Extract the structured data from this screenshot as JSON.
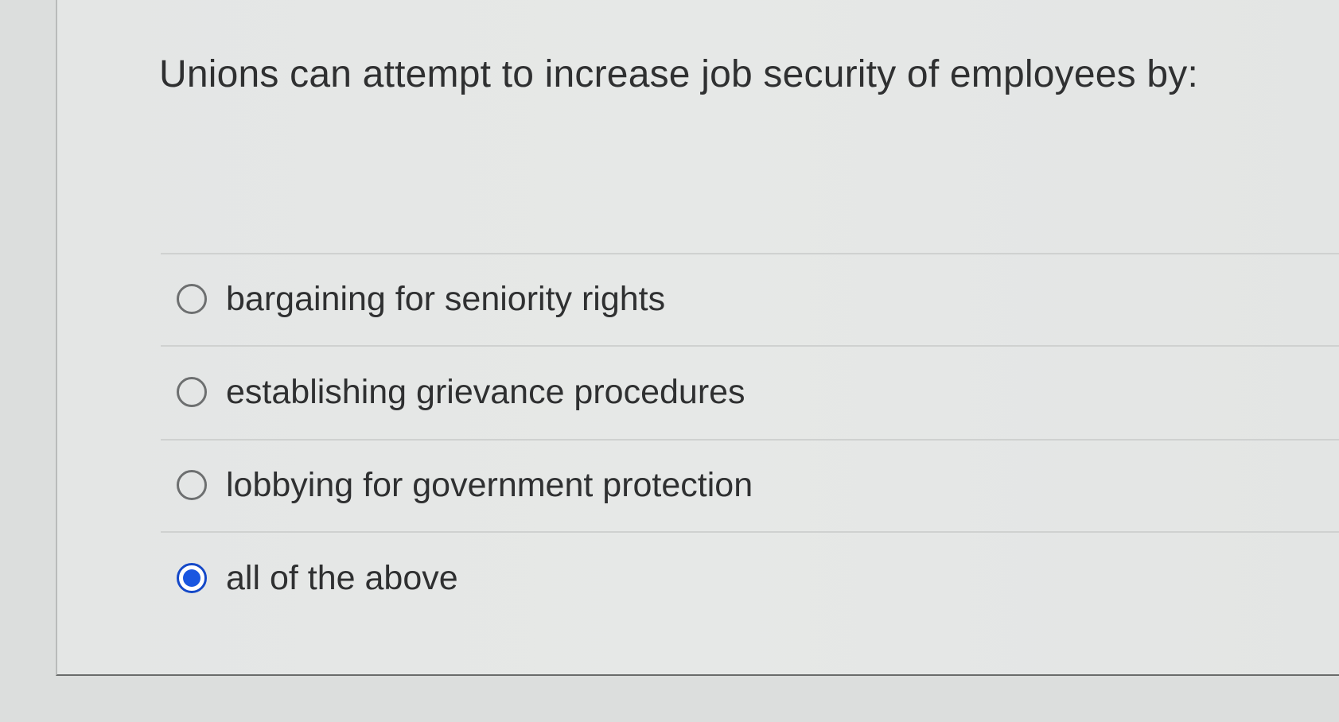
{
  "question": {
    "text": "Unions can attempt to increase job security of employees by:"
  },
  "options": [
    {
      "label": "bargaining for seniority rights",
      "selected": false
    },
    {
      "label": "establishing grievance procedures",
      "selected": false
    },
    {
      "label": "lobbying for government protection",
      "selected": false
    },
    {
      "label": "all of the above",
      "selected": true
    }
  ],
  "colors": {
    "selected_radio": "#1a56e0",
    "text": "#2f3031",
    "background": "#e4e6e5"
  }
}
